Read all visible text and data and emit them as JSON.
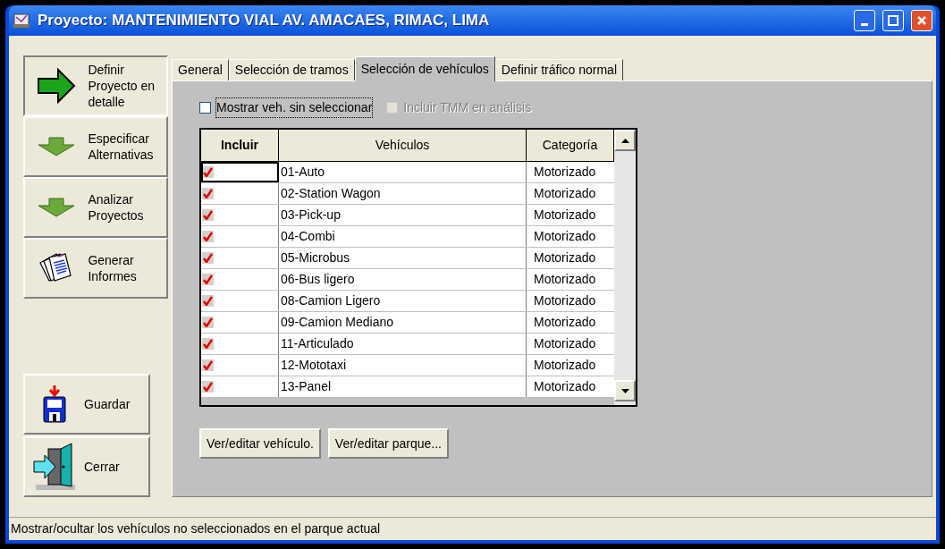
{
  "window": {
    "title": "Proyecto: MANTENIMIENTO VIAL AV. AMACAES, RIMAC, LIMA"
  },
  "sidebar": {
    "items": [
      {
        "label": "Definir Proyecto en detalle",
        "kind": "arrow-right",
        "selected": true
      },
      {
        "label": "Especificar Alternativas",
        "kind": "arrow-down",
        "selected": false
      },
      {
        "label": "Analizar Proyectos",
        "kind": "arrow-down",
        "selected": false
      },
      {
        "label": "Generar Informes",
        "kind": "reports",
        "selected": false
      }
    ],
    "actions": [
      {
        "label": "Guardar",
        "kind": "save"
      },
      {
        "label": "Cerrar",
        "kind": "exit"
      }
    ]
  },
  "tabs": [
    {
      "label": "General",
      "selected": false
    },
    {
      "label": "Selección de tramos",
      "selected": false
    },
    {
      "label": "Selección de vehículos",
      "selected": true
    },
    {
      "label": "Definir tráfico normal",
      "selected": false
    }
  ],
  "options": [
    {
      "label": "Mostrar veh. sin seleccionar",
      "checked": false,
      "disabled": false,
      "focused": true
    },
    {
      "label": "Incluir TMM en análisis",
      "checked": false,
      "disabled": true,
      "focused": false
    }
  ],
  "table": {
    "columns": [
      "Incluir",
      "Vehículos",
      "Categoría"
    ],
    "rows": [
      {
        "included": true,
        "selected": true,
        "vehicle": "01-Auto",
        "category": "Motorizado"
      },
      {
        "included": true,
        "selected": false,
        "vehicle": "02-Station Wagon",
        "category": "Motorizado"
      },
      {
        "included": true,
        "selected": false,
        "vehicle": "03-Pick-up",
        "category": "Motorizado"
      },
      {
        "included": true,
        "selected": false,
        "vehicle": "04-Combi",
        "category": "Motorizado"
      },
      {
        "included": true,
        "selected": false,
        "vehicle": "05-Microbus",
        "category": "Motorizado"
      },
      {
        "included": true,
        "selected": false,
        "vehicle": "06-Bus ligero",
        "category": "Motorizado"
      },
      {
        "included": true,
        "selected": false,
        "vehicle": "08-Camion Ligero",
        "category": "Motorizado"
      },
      {
        "included": true,
        "selected": false,
        "vehicle": "09-Camion Mediano",
        "category": "Motorizado"
      },
      {
        "included": true,
        "selected": false,
        "vehicle": "11-Articulado",
        "category": "Motorizado"
      },
      {
        "included": true,
        "selected": false,
        "vehicle": "12-Mototaxi",
        "category": "Motorizado"
      },
      {
        "included": true,
        "selected": false,
        "vehicle": "13-Panel",
        "category": "Motorizado"
      }
    ]
  },
  "buttons": [
    "Ver/editar vehículo.",
    "Ver/editar parque..."
  ],
  "status_bar": "Mostrar/ocultar los vehículos no seleccionados en el parque actual"
}
